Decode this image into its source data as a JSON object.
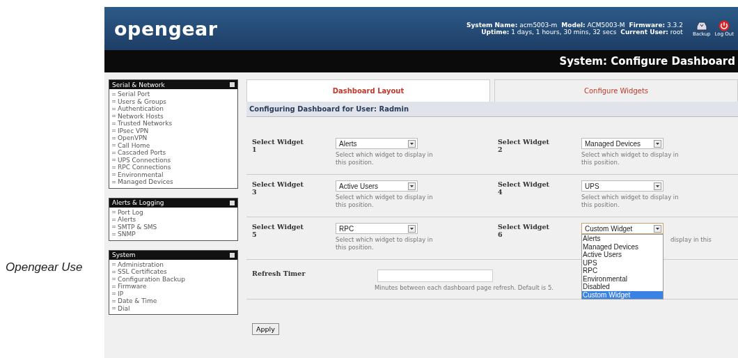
{
  "caption": "Opengear Use",
  "header": {
    "logo": "opengear",
    "info_line_1": [
      {
        "label": "System Name:",
        "value": "acm5003-m"
      },
      {
        "label": "Model:",
        "value": "ACM5003-M"
      },
      {
        "label": "Firmware:",
        "value": "3.3.2"
      }
    ],
    "info_line_2": [
      {
        "label": "Uptime:",
        "value": "1 days, 1 hours, 30 mins, 32 secs"
      },
      {
        "label": "Current User:",
        "value": "root"
      }
    ],
    "actions": [
      {
        "kind": "backup",
        "label": "Backup"
      },
      {
        "kind": "logout",
        "label": "Log Out"
      }
    ]
  },
  "page_title": "System: Configure Dashboard",
  "sidebar": [
    {
      "title": "Serial & Network",
      "items": [
        "Serial Port",
        "Users & Groups",
        "Authentication",
        "Network Hosts",
        "Trusted Networks",
        "IPsec VPN",
        "OpenVPN",
        "Call Home",
        "Cascaded Ports",
        "UPS Connections",
        "RPC Connections",
        "Environmental",
        "Managed Devices"
      ]
    },
    {
      "title": "Alerts & Logging",
      "items": [
        "Port Log",
        "Alerts",
        "SMTP & SMS",
        "SNMP"
      ]
    },
    {
      "title": "System",
      "items": [
        "Administration",
        "SSL Certificates",
        "Configuration Backup",
        "Firmware",
        "IP",
        "Date & Time",
        "Dial"
      ]
    }
  ],
  "tabs": [
    {
      "label": "Dashboard Layout",
      "selected": true
    },
    {
      "label": "Configure Widgets",
      "selected": false
    }
  ],
  "section_title": "Configuring Dashboard for User: Radmin",
  "widgets": [
    {
      "label": "Select Widget",
      "number": "1",
      "value": "Alerts",
      "hint": "Select which widget to display in this position.",
      "expanded": false
    },
    {
      "label": "Select Widget",
      "number": "2",
      "value": "Managed Devices",
      "hint": "Select which widget to display in this position.",
      "expanded": false
    },
    {
      "label": "Select Widget",
      "number": "3",
      "value": "Active Users",
      "hint": "Select which widget to display in this position.",
      "expanded": false
    },
    {
      "label": "Select Widget",
      "number": "4",
      "value": "UPS",
      "hint": "Select which widget to display in this position.",
      "expanded": false
    },
    {
      "label": "Select Widget",
      "number": "5",
      "value": "RPC",
      "hint": "Select which widget to display in this position.",
      "expanded": false
    },
    {
      "label": "Select Widget",
      "number": "6",
      "value": "Custom Widget",
      "hint": "display in this",
      "expanded": true
    }
  ],
  "dropdown_options": [
    {
      "label": "Alerts",
      "selected": false
    },
    {
      "label": "Managed Devices",
      "selected": false
    },
    {
      "label": "Active Users",
      "selected": false
    },
    {
      "label": "UPS",
      "selected": false
    },
    {
      "label": "RPC",
      "selected": false
    },
    {
      "label": "Environmental",
      "selected": false
    },
    {
      "label": "Disabled",
      "selected": false
    },
    {
      "label": "Custom Widget",
      "selected": true
    }
  ],
  "refresh": {
    "label": "Refresh Timer",
    "hint": "Minutes between each dashboard page refresh. Default is 5."
  },
  "apply_button": "Apply"
}
